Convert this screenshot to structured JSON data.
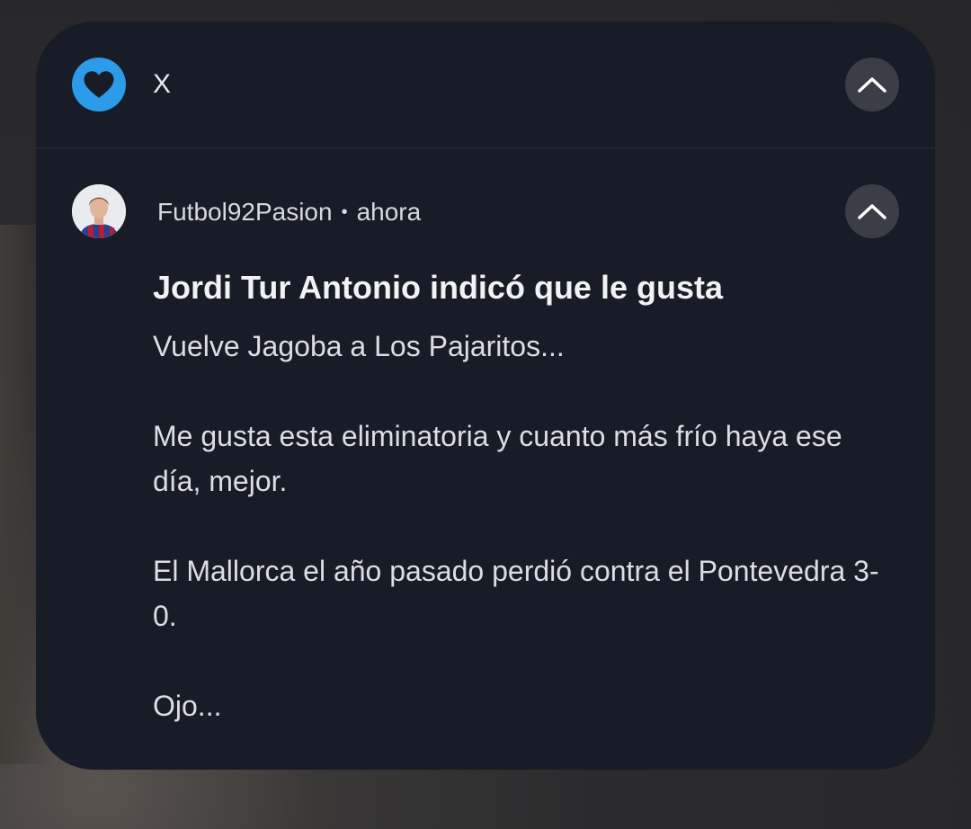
{
  "app": {
    "name": "X",
    "icon": "heart-icon",
    "icon_color": "#2b9bea"
  },
  "notification": {
    "sender": "Futbol92Pasion",
    "separator": "•",
    "time": "ahora",
    "title": "Jordi Tur Antonio indicó que le gusta",
    "body": [
      "Vuelve Jagoba a Los Pajaritos...",
      "Me gusta esta eliminatoria y cuanto más frío haya ese día, mejor.",
      "El Mallorca el año pasado perdió contra el Pontevedra 3-0.",
      "Ojo..."
    ]
  },
  "colors": {
    "card_background": "#181c26",
    "button_background": "#3b3e46"
  }
}
